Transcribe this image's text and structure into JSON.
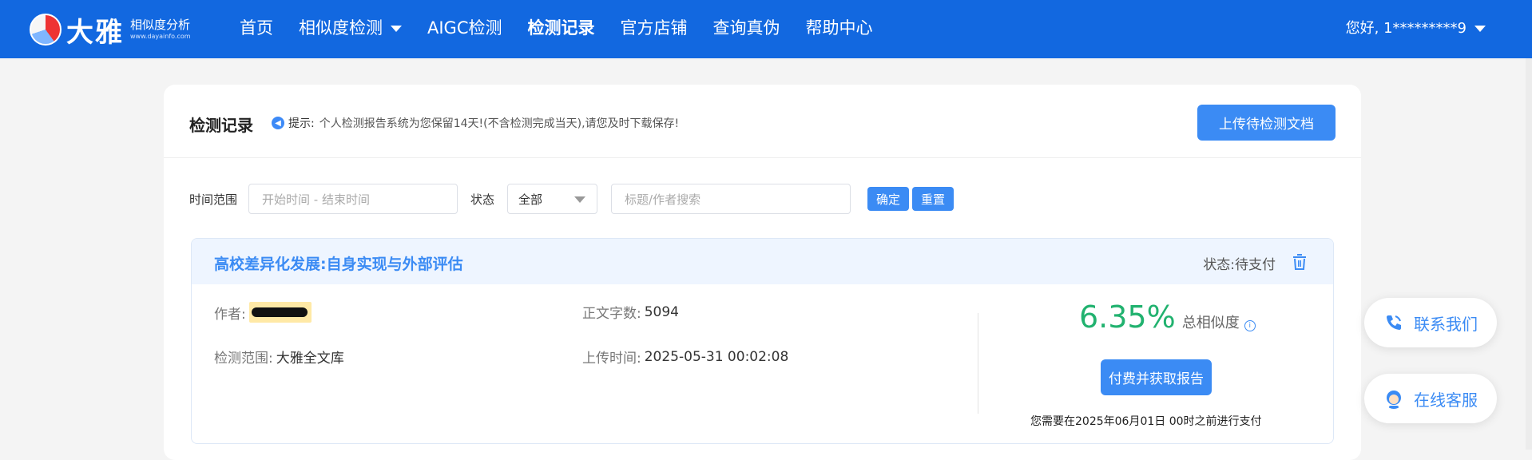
{
  "header": {
    "logo_text": "大雅",
    "logo_subtitle": "相似度分析",
    "logo_url": "www.dayainfo.com",
    "nav": [
      {
        "label": "首页"
      },
      {
        "label": "相似度检测"
      },
      {
        "label": "AIGC检测"
      },
      {
        "label": "检测记录",
        "active": true
      },
      {
        "label": "官方店铺"
      },
      {
        "label": "查询真伪"
      },
      {
        "label": "帮助中心"
      }
    ],
    "user_greeting": "您好, 1*********9"
  },
  "panel": {
    "title": "检测记录",
    "tip_label": "提示:",
    "tip_text": "个人检测报告系统为您保留14天!(不含检测完成当天),请您及时下载保存!",
    "upload_button": "上传待检测文档"
  },
  "filters": {
    "time_label": "时间范围",
    "time_placeholder": "开始时间 - 结束时间",
    "status_label": "状态",
    "status_value": "全部",
    "search_placeholder": "标题/作者搜索",
    "confirm_button": "确定",
    "reset_button": "重置"
  },
  "record": {
    "title": "高校差异化发展:自身实现与外部评估",
    "status_label": "状态:",
    "status_value": "待支付",
    "author_label": "作者:",
    "word_count_label": "正文字数:",
    "word_count": "5094",
    "scope_label": "检测范围:",
    "scope_value": "大雅全文库",
    "upload_time_label": "上传时间:",
    "upload_time": "2025-05-31 00:02:08",
    "similarity": "6.35%",
    "similarity_label": "总相似度",
    "pay_button": "付费并获取报告",
    "deadline": "您需要在2025年06月01日 00时之前进行支付"
  },
  "floating": {
    "contact": "联系我们",
    "online_service": "在线客服"
  },
  "colors": {
    "brand": "#1268e0",
    "accent": "#3b8bf4",
    "similarity": "#21b26f"
  }
}
